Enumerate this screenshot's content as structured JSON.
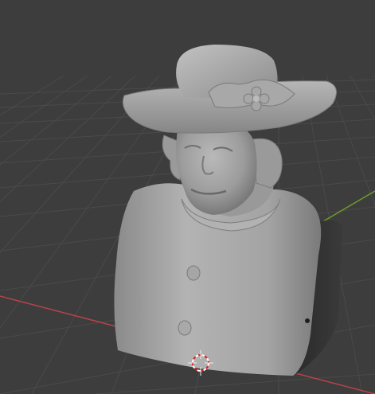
{
  "viewport": {
    "background": "#3d3d3d",
    "grid_color": "#4a4a4a",
    "x_axis_color": "#b8424a",
    "y_axis_color": "#6f9a2d"
  },
  "model": {
    "subject": "bust-sculpture-with-hat",
    "shading": "solid",
    "surface_color": "#9b9b9b"
  },
  "icons": {
    "cursor": "3d-cursor-icon"
  }
}
